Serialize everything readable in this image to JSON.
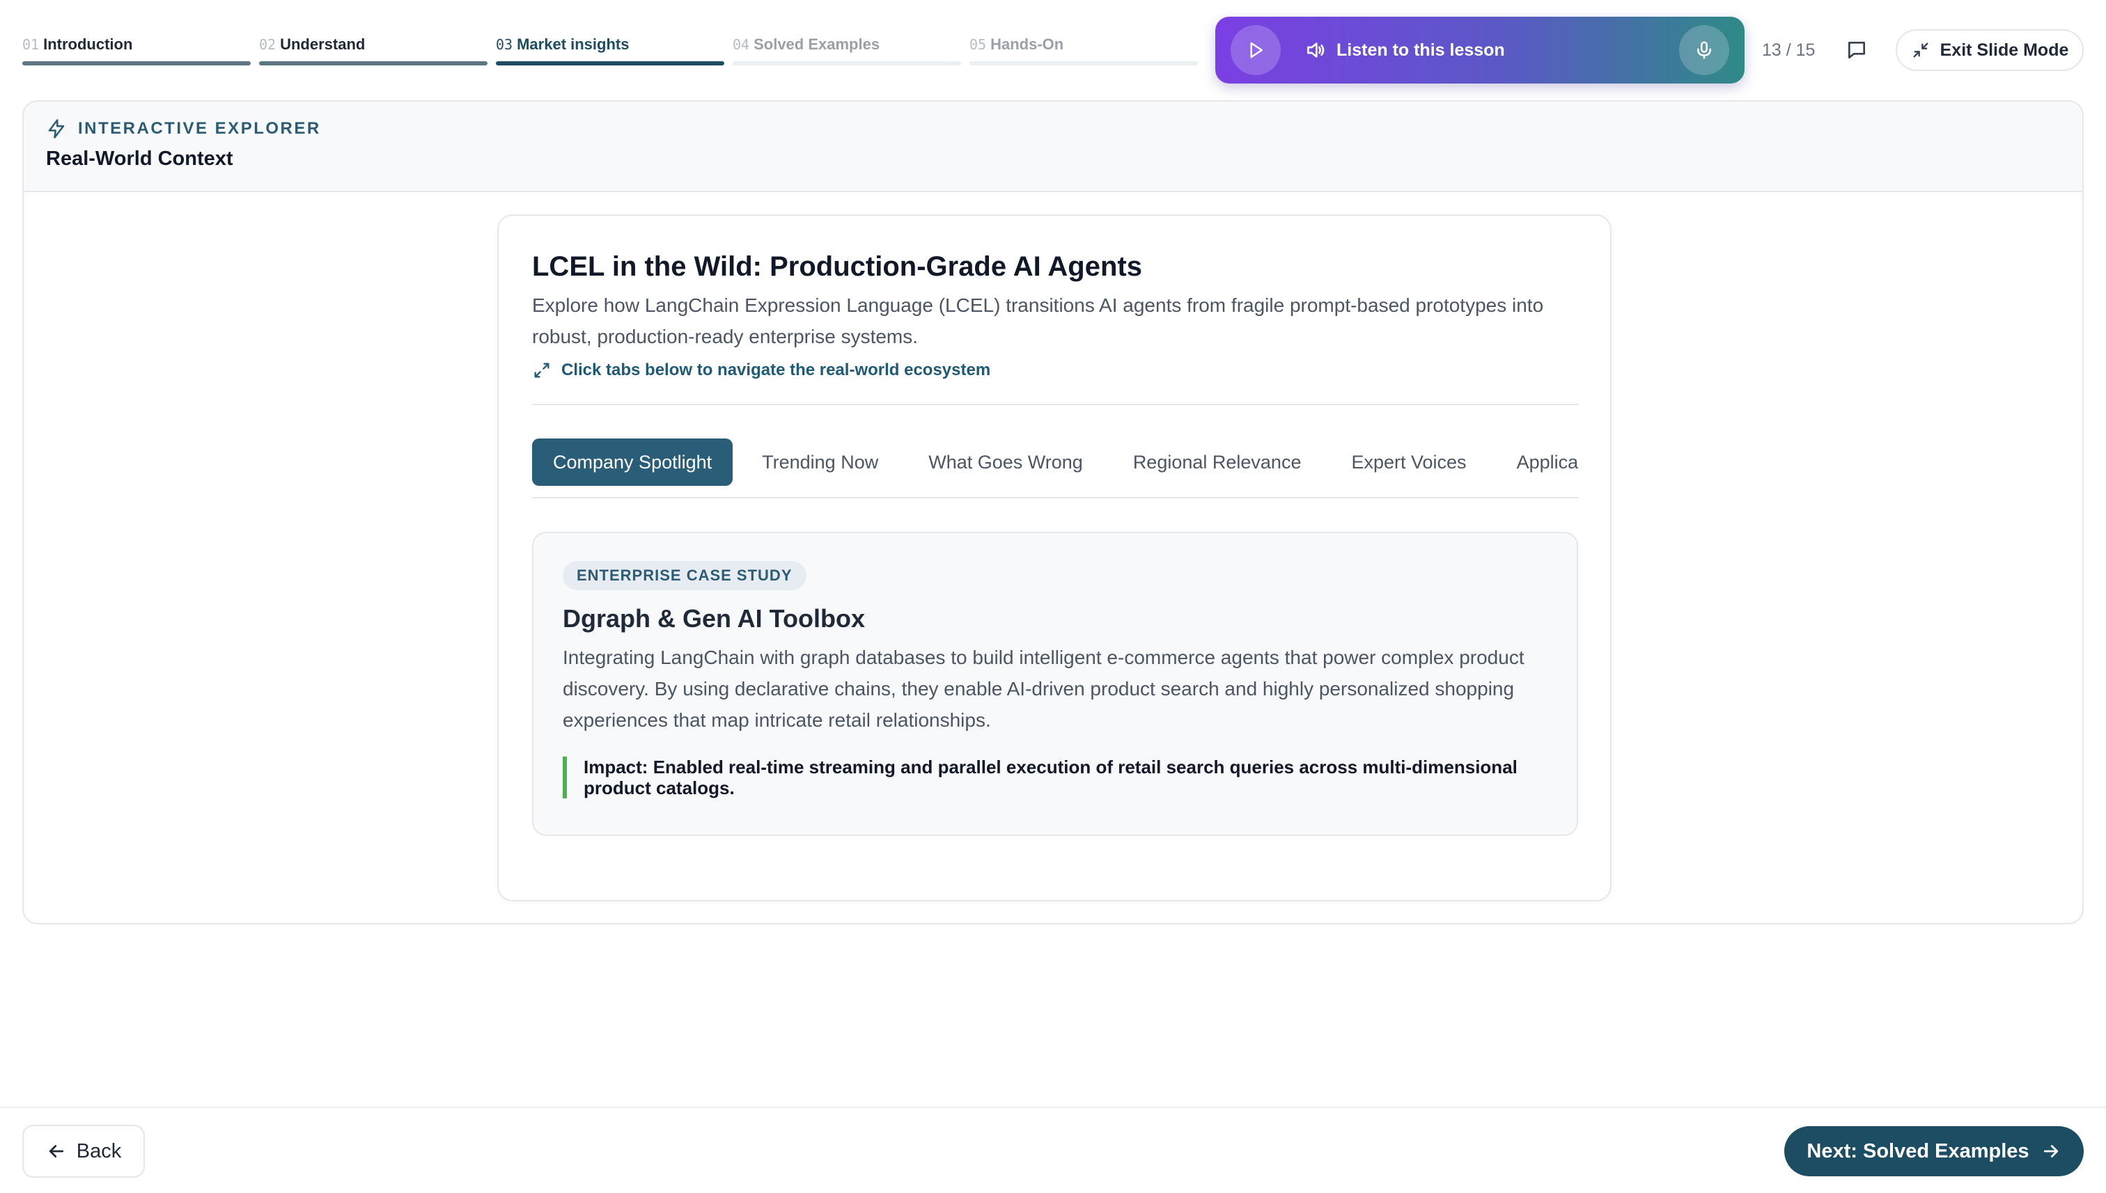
{
  "steps": [
    {
      "num": "01",
      "label": "Introduction",
      "state": "done"
    },
    {
      "num": "02",
      "label": "Understand",
      "state": "done"
    },
    {
      "num": "03",
      "label": "Market insights",
      "state": "active"
    },
    {
      "num": "04",
      "label": "Solved Examples",
      "state": "todo"
    },
    {
      "num": "05",
      "label": "Hands-On",
      "state": "todo"
    }
  ],
  "audio": {
    "label": "Listen to this lesson",
    "play_icon": "play-icon",
    "speaker_icon": "speaker-icon",
    "mic_icon": "microphone-icon"
  },
  "slide_counter": "13 / 15",
  "toolbar": {
    "comment_icon": "comment-icon",
    "exit_label": "Exit Slide Mode",
    "exit_icon": "minimize-icon"
  },
  "explorer": {
    "kicker": "INTERACTIVE EXPLORER",
    "title": "Real-World Context",
    "kicker_icon": "lightning-icon"
  },
  "card": {
    "title": "LCEL in the Wild: Production-Grade AI Agents",
    "description": "Explore how LangChain Expression Language (LCEL) transitions AI agents from fragile prompt-based prototypes into robust, production-ready enterprise systems.",
    "hint": "Click tabs below to navigate the real-world ecosystem",
    "hint_icon": "expand-icon"
  },
  "tabs": [
    {
      "label": "Company Spotlight",
      "active": true
    },
    {
      "label": "Trending Now",
      "active": false
    },
    {
      "label": "What Goes Wrong",
      "active": false
    },
    {
      "label": "Regional Relevance",
      "active": false
    },
    {
      "label": "Expert Voices",
      "active": false
    },
    {
      "label": "Applications",
      "active": false
    }
  ],
  "panel": {
    "badge": "ENTERPRISE CASE STUDY",
    "title": "Dgraph & Gen AI Toolbox",
    "description": "Integrating LangChain with graph databases to build intelligent e-commerce agents that power complex product discovery. By using declarative chains, they enable AI-driven product search and highly personalized shopping experiences that map intricate retail relationships.",
    "impact_label": "Impact:",
    "impact_text": " Enabled real-time streaming and parallel execution of retail search queries across multi-dimensional product catalogs."
  },
  "footer": {
    "back_label": "Back",
    "back_icon": "arrow-left-icon",
    "next_label": "Next: Solved Examples",
    "next_icon": "arrow-right-icon"
  },
  "colors": {
    "accent": "#1e4d62",
    "tab_active": "#2a5e78",
    "impact_border": "#4caf50",
    "audio_gradient_start": "#7b3fe4",
    "audio_gradient_end": "#2f8a86"
  }
}
